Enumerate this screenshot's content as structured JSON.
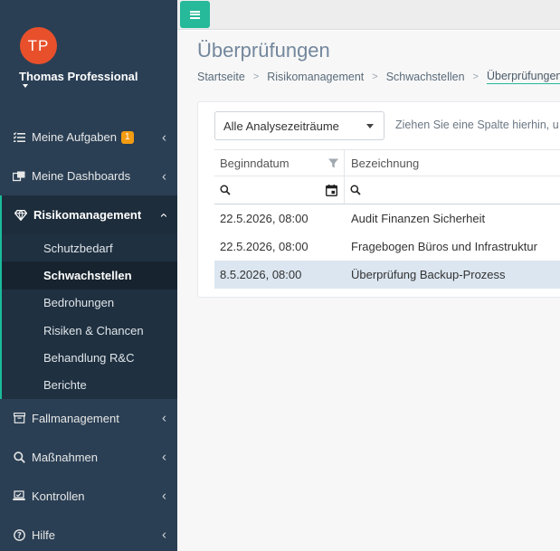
{
  "profile": {
    "initials": "TP",
    "name": "Thomas Professional"
  },
  "sidebar": {
    "items": [
      {
        "label": "Meine Aufgaben",
        "badge": "1",
        "icon": "tasks-icon"
      },
      {
        "label": "Meine Dashboards",
        "icon": "dashboard-icon"
      },
      {
        "label": "Risikomanagement",
        "icon": "diamond-icon"
      },
      {
        "label": "Fallmanagement",
        "icon": "archive-icon"
      },
      {
        "label": "Maßnahmen",
        "icon": "search-icon"
      },
      {
        "label": "Kontrollen",
        "icon": "laptop-icon"
      },
      {
        "label": "Hilfe",
        "icon": "question-icon"
      }
    ],
    "submenu": [
      {
        "label": "Schutzbedarf"
      },
      {
        "label": "Schwachstellen"
      },
      {
        "label": "Bedrohungen"
      },
      {
        "label": "Risiken & Chancen"
      },
      {
        "label": "Behandlung R&C"
      },
      {
        "label": "Berichte"
      }
    ]
  },
  "main": {
    "title": "Überprüfungen",
    "breadcrumb": [
      "Startseite",
      "Risikomanagement",
      "Schwachstellen",
      "Überprüfungen"
    ],
    "breadcrumb_sep": ">",
    "period_select": "Alle Analysezeiträume",
    "group_hint": "Ziehen Sie eine Spalte hierhin, u",
    "columns": [
      "Beginndatum",
      "Bezeichnung"
    ],
    "rows": [
      {
        "date": "22.5.2026, 08:00",
        "name": "Audit Finanzen Sicherheit"
      },
      {
        "date": "22.5.2026, 08:00",
        "name": "Fragebogen Büros und Infrastruktur"
      },
      {
        "date": "8.5.2026, 08:00",
        "name": "Überprüfung Backup-Prozess"
      }
    ]
  },
  "colors": {
    "accent": "#26b99a",
    "sidebar": "#2a3f54",
    "avatar": "#e8502c",
    "badge": "#f39c12",
    "selected_row": "#dbe6f0"
  }
}
